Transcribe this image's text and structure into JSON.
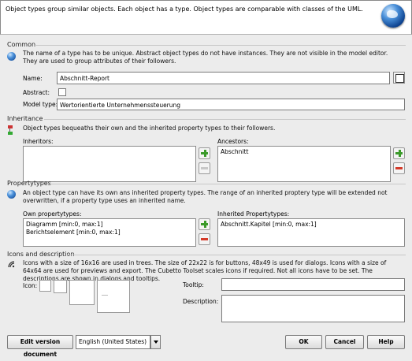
{
  "header": {
    "description": "Object types group similar objects. Each object has a type. Object types are comparable with classes of the UML."
  },
  "common": {
    "title": "Common",
    "description": "The name of a type has to be unique. Abstract object types do not have instances. They are not visible in the model editor. They are used to group attributes of their followers.",
    "name_label": "Name:",
    "name_value": "Abschnitt-Report",
    "abstract_label": "Abstract:",
    "modeltype_label": "Model type:",
    "modeltype_value": "Wertorientierte Unternehmenssteuerung"
  },
  "inheritance": {
    "title": "Inheritance",
    "description": "Object types bequeaths their own and the inherited property types to their followers.",
    "inheritors_label": "Inheritors:",
    "inheritors": [],
    "ancestors_label": "Ancestors:",
    "ancestors": [
      "Abschnitt"
    ]
  },
  "propertytypes": {
    "title": "Propertytypes",
    "description": "An object type can have its own ans inherited property types. The range of an inherited proptery type will be extended not overwritten, if a property type uses an inherited name.",
    "own_label": "Own propertytypes:",
    "own": [
      "Diagramm [min:0, max:1]",
      "Berichtselement [min:0, max:1]"
    ],
    "inherited_label": "Inherited Propertytypes:",
    "inherited": [
      "Abschnitt.Kapitel [min:0, max:1]"
    ]
  },
  "icons": {
    "title": "Icons and description",
    "description": "Icons with a size of 16x16 are used in trees. The size of 22x22 is for buttons, 48x49 is used for dialogs. Icons with a size of 64x64 are used for previews and export. The Cubetto Toolset scales icons if required. Not all icons have to be set. The descriptions are shown in dialogs and tooltips.",
    "icon_label": "Icon:",
    "tooltip_label": "Tooltip:",
    "tooltip_value": "",
    "description_label": "Description:",
    "description_value": ""
  },
  "footer": {
    "edit_version_label": "Edit version document",
    "language_value": "English (United States)",
    "ok_label": "OK",
    "cancel_label": "Cancel",
    "help_label": "Help"
  }
}
